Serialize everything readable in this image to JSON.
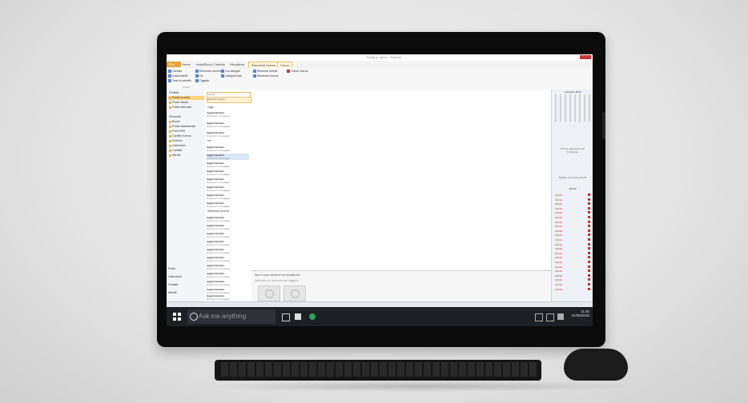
{
  "window": {
    "title": "Posta in arrivo - Outlook",
    "tabs": [
      "File",
      "Home",
      "Invia/Ricevi",
      "Cartella",
      "Visualizza",
      "Strumenti ricerca",
      "Cerca"
    ],
    "file_tab": "File",
    "contextual_tab": "Strumenti ricerca"
  },
  "ribbon": {
    "items": [
      "Cartella",
      "Sottocartelle",
      "Tutte le cartelle",
      "Elemento corrente",
      "Da",
      "Oggetto",
      "Con allegati",
      "Categorizzati",
      "Ricerche recenti",
      "Strumenti ricerca",
      "Chiudi ricerca"
    ],
    "group_label": "Ambito"
  },
  "nav": {
    "items": [
      "Preferiti",
      "Posta in arrivo",
      "Posta inviata",
      "Posta eliminata",
      "Personali",
      "Bozze",
      "Posta indesiderata",
      "Feed RSS",
      "Cartelle ricerca",
      "Archivio",
      "Calendario",
      "Contatti",
      "Attività"
    ],
    "selected": "Posta in arrivo",
    "bottom": [
      "Posta",
      "Calendario",
      "Contatti",
      "Attività"
    ]
  },
  "list": {
    "search_value": "Cerca",
    "dropdown": "Ricerche recenti",
    "groups": [
      "Oggi",
      "Ieri",
      "Settimana scorsa"
    ],
    "mail_subject": "Aggiornamento",
    "mail_preview": "Ricevuto il messaggio",
    "count": 22
  },
  "reading": {
    "info_line": "Non ci sono elementi da visualizzare",
    "subinfo": "Seleziona un elemento per leggerlo"
  },
  "todo": {
    "calendar_title": "settembre 2015",
    "no_appointments": "Nessun appuntamento imminente.",
    "tasks_header": "Digitare una nuova attività",
    "task_label": "Attività",
    "tasks_count": 22
  },
  "taskbar": {
    "search_placeholder": "Ask me anything",
    "time": "11:50",
    "date": "21/09/2015"
  },
  "colors": {
    "accent": "#e8a33c",
    "selected_folder": "#f9d37d",
    "flag": "#c62828",
    "taskbar": "#1c1f24"
  }
}
